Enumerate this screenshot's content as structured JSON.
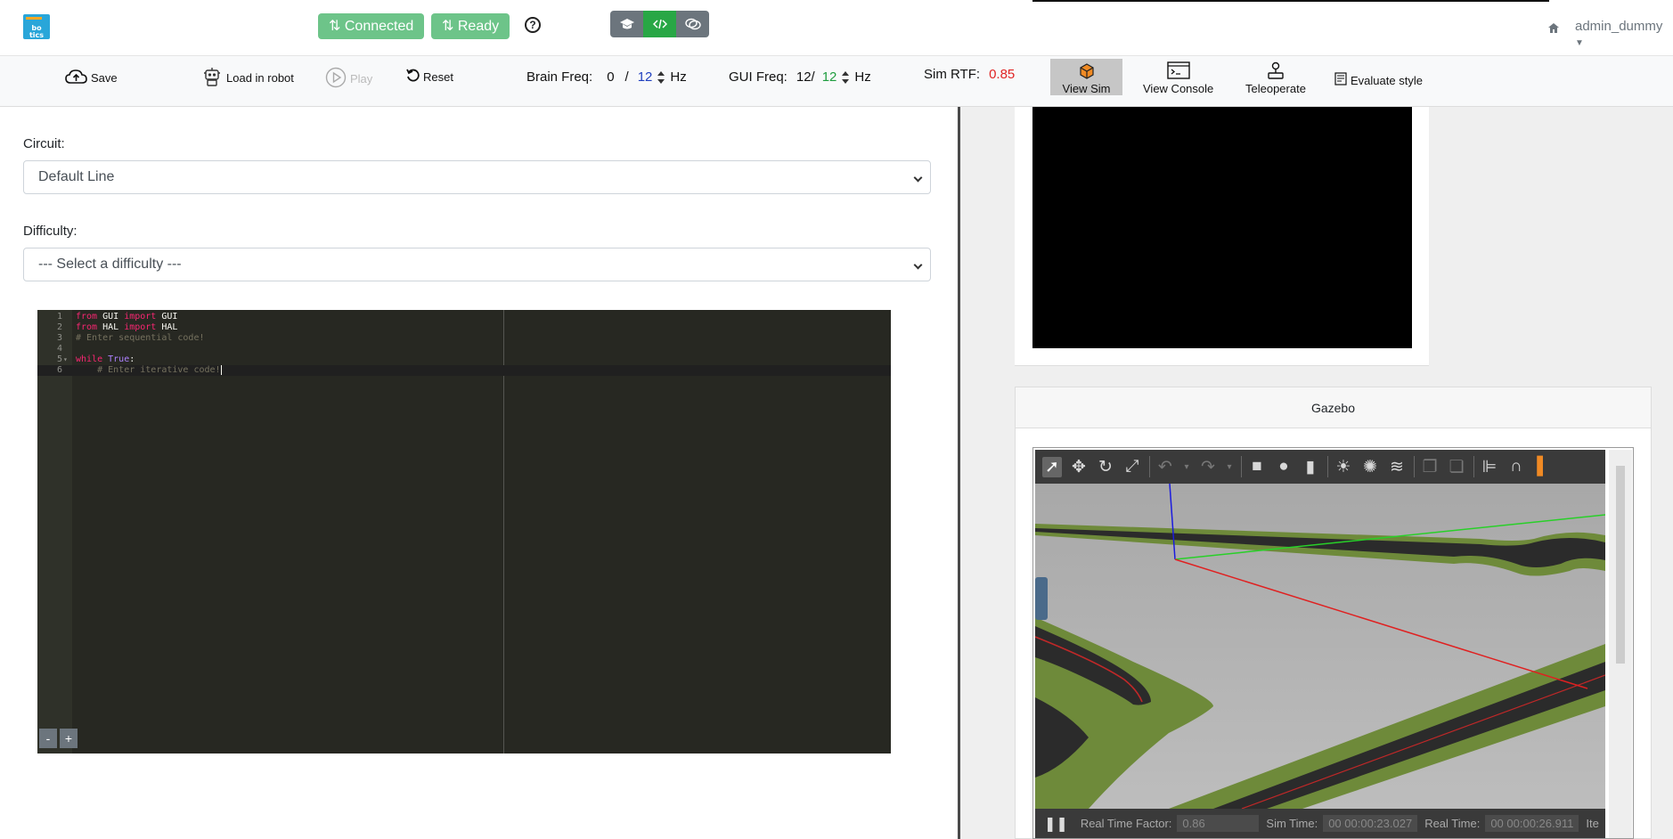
{
  "nav": {
    "logo_text": "bo tics",
    "connected_label": "Connected",
    "ready_label": "Ready",
    "help_icon": "question-circle-icon",
    "user_name": "admin_dummy",
    "mode_buttons": [
      "graduation-cap-icon",
      "code-icon",
      "chat-icon"
    ]
  },
  "toolbar": {
    "save_label": "Save",
    "load_label": "Load in robot",
    "play_label": "Play",
    "reset_label": "Reset",
    "brain_freq_label": "Brain Freq:",
    "brain_freq_current": "0",
    "brain_freq_sep": "/",
    "brain_freq_target": "12",
    "hz1": "Hz",
    "gui_freq_label": "GUI Freq:",
    "gui_freq_current": "12/",
    "gui_freq_target": "12",
    "hz2": "Hz",
    "sim_rtf_label": "Sim RTF:",
    "sim_rtf_value": "0.85",
    "view_sim_label": "View Sim",
    "view_console_label": "View Console",
    "teleoperate_label": "Teleoperate",
    "evaluate_label": "Evaluate style"
  },
  "form": {
    "circuit_label": "Circuit:",
    "circuit_value": "Default Line",
    "difficulty_label": "Difficulty:",
    "difficulty_value": "--- Select a difficulty ---"
  },
  "editor": {
    "line_numbers": [
      "1",
      "2",
      "3",
      "4",
      "5",
      "6"
    ],
    "line1": {
      "kw1": "from",
      "mod": " GUI ",
      "kw2": "import",
      "name": " GUI"
    },
    "line2": {
      "kw1": "from",
      "mod": " HAL ",
      "kw2": "import",
      "name": " HAL"
    },
    "line3": "# Enter sequential code!",
    "line5": {
      "kw": "while",
      "sp": " ",
      "bi": "True",
      "rest": ":"
    },
    "line6_indent": "    ",
    "line6": "# Enter iterative code!",
    "zoom_out": "-",
    "zoom_in": "+"
  },
  "gazebo": {
    "title": "Gazebo",
    "rtf_label": "Real Time Factor:",
    "rtf_value": "0.86",
    "sim_time_label": "Sim Time:",
    "sim_time_value": "00 00:00:23.027",
    "real_time_label": "Real Time:",
    "real_time_value": "00 00:00:26.911",
    "iter_label": "Ite"
  },
  "colors": {
    "connected_bg": "#6dc489",
    "rtf_red": "#e02424",
    "freq_blue": "#1f3fbf",
    "freq_green": "#1f9d3f"
  }
}
